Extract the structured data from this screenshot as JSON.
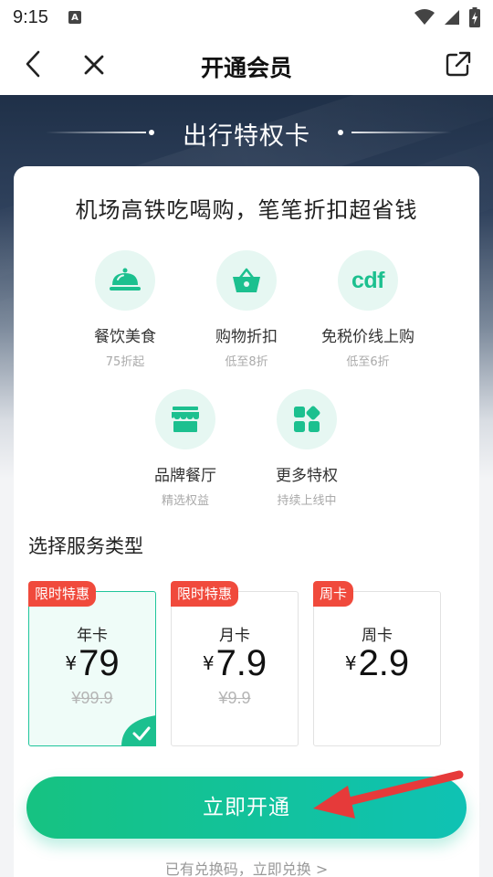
{
  "status_bar": {
    "time": "9:15",
    "notification_icon_label": "A"
  },
  "nav": {
    "title": "开通会员"
  },
  "banner": {
    "title": "出行特权卡"
  },
  "card": {
    "headline": "机场高铁吃喝购，笔笔折扣超省钱",
    "benefits": [
      {
        "icon": "dining-cloche-icon",
        "name": "餐饮美食",
        "sub": "75折起"
      },
      {
        "icon": "shopping-basket-icon",
        "name": "购物折扣",
        "sub": "低至8折"
      },
      {
        "icon": "cdf-logo",
        "logo_text": "cdf",
        "name": "免税价线上购",
        "sub": "低至6折"
      },
      {
        "icon": "storefront-icon",
        "name": "品牌餐厅",
        "sub": "精选权益"
      },
      {
        "icon": "more-apps-icon",
        "name": "更多特权",
        "sub": "持续上线中"
      }
    ],
    "section_title": "选择服务类型",
    "plans": [
      {
        "tag": "限时特惠",
        "name": "年卡",
        "currency": "¥",
        "price": "79",
        "original_price": "¥99.9",
        "selected": true
      },
      {
        "tag": "限时特惠",
        "name": "月卡",
        "currency": "¥",
        "price": "7.9",
        "original_price": "¥9.9",
        "selected": false
      },
      {
        "tag": "周卡",
        "name": "周卡",
        "currency": "¥",
        "price": "2.9",
        "original_price": "",
        "selected": false
      }
    ],
    "cta_label": "立即开通",
    "redeem_link": "已有兑换码，立即兑换 >"
  },
  "colors": {
    "accent_green": "#16c281",
    "accent_teal": "#0fc2b4",
    "tag_red": "#f04a3c",
    "icon_bg": "#e6f7f2",
    "banner_dark": "#1f3048"
  }
}
